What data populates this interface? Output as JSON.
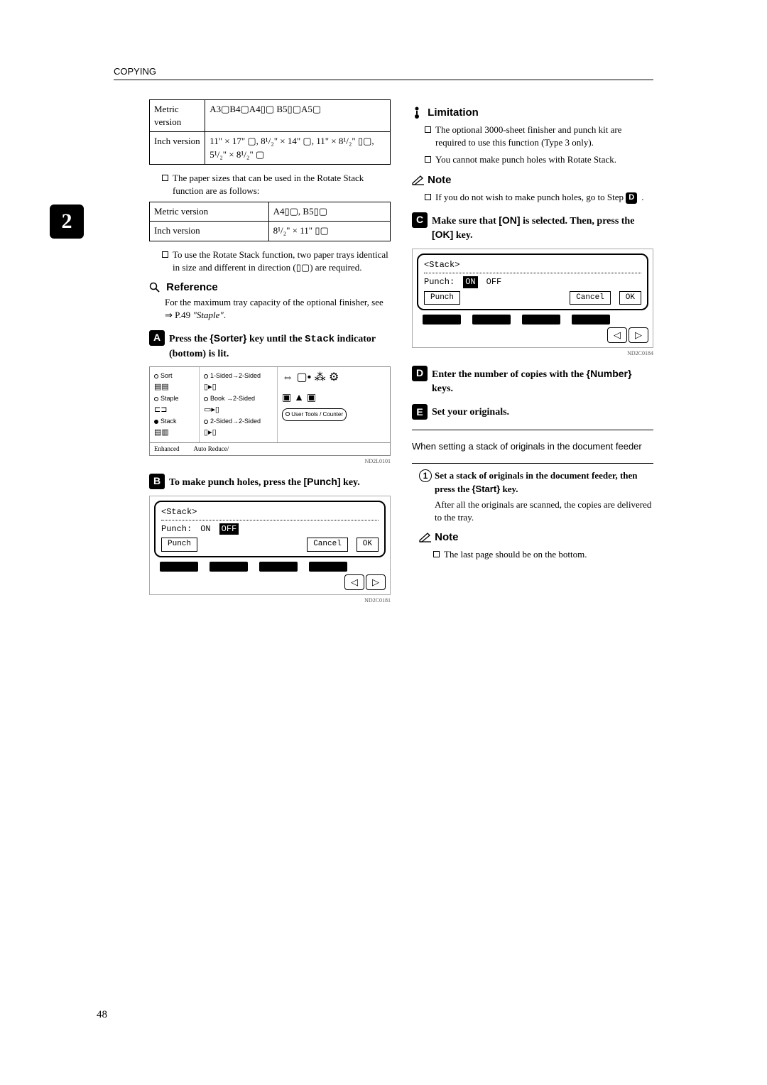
{
  "header": {
    "title": "COPYING"
  },
  "tab": {
    "number": "2"
  },
  "page_number": "48",
  "left": {
    "table1": {
      "r1c1": "Metric version",
      "r1c2": "A3▢B4▢A4▯▢ B5▯▢A5▢",
      "r2c1": "Inch version",
      "r2c2": "11\" × 17\" ▢, 8¹/₂\" × 14\" ▢, 11\" × 8¹/₂\" ▯▢, 5¹/₂\" × 8¹/₂\" ▢"
    },
    "bullet1": "The paper sizes that can be used in the Rotate Stack function are as follows:",
    "table2": {
      "r1c1": "Metric version",
      "r1c2": "A4▯▢, B5▯▢",
      "r2c1": "Inch version",
      "r2c2": "8¹/₂\" × 11\" ▯▢"
    },
    "bullet2": "To use the Rotate Stack function, two paper trays identical in size and different in direction (▯▢) are required.",
    "reference_title": "Reference",
    "reference_body_a": "For the maximum tray capacity of the optional finisher, see ⇒ P.49 ",
    "reference_body_b": "\"Staple\"",
    "reference_body_c": ".",
    "step1_a": "Press the ",
    "step1_key": "{Sorter}",
    "step1_b": " key until the ",
    "step1_code": "Stack",
    "step1_c": " indicator (bottom) is lit.",
    "sort_panel": {
      "sort": "Sort",
      "staple": "Staple",
      "stack": "Stack",
      "m1": "1-Sided→2-Sided",
      "m2": "Book →2-Sided",
      "m3": "2-Sided→2-Sided",
      "ut": "User Tools / Counter",
      "enh": "Enhanced",
      "ar": "Auto Reduce/",
      "cap": "ND2L0101"
    },
    "step2_a": "To make punch holes, press the ",
    "step2_key": "[Punch]",
    "step2_b": " key.",
    "lcd1": {
      "title": "<Stack>",
      "punch_label": "Punch:",
      "on": "ON",
      "off": "OFF",
      "punch_btn": "Punch",
      "cancel": "Cancel",
      "ok": "OK",
      "cap": "ND2C0181"
    }
  },
  "right": {
    "limitation_title": "Limitation",
    "lim1": "The optional 3000-sheet finisher and punch kit are required to use this function (Type 3 only).",
    "lim2": "You cannot make punch holes with Rotate Stack.",
    "note1_title": "Note",
    "note1_a": "If you do not wish to make punch holes, go to Step ",
    "note1_step": "D",
    "note1_b": ".",
    "step3_a": "Make sure that ",
    "step3_key1": "[ON]",
    "step3_b": " is selected. Then, press the ",
    "step3_key2": "[OK]",
    "step3_c": " key.",
    "lcd2": {
      "title": "<Stack>",
      "punch_label": "Punch:",
      "on": "ON",
      "off": "OFF",
      "punch_btn": "Punch",
      "cancel": "Cancel",
      "ok": "OK",
      "cap": "ND2C0184"
    },
    "step4_a": "Enter the number of copies with the ",
    "step4_key": "{Number}",
    "step4_b": " keys.",
    "step5": "Set your originals.",
    "subhead": "When setting a stack of originals in the document feeder",
    "sub1_a": "Set a stack of originals in the document feeder, then press the ",
    "sub1_key": "{Start}",
    "sub1_b": " key.",
    "sub1_body": "After all the originals are scanned, the copies are delivered to the tray.",
    "note2_title": "Note",
    "note2": "The last page should be on the bottom."
  }
}
